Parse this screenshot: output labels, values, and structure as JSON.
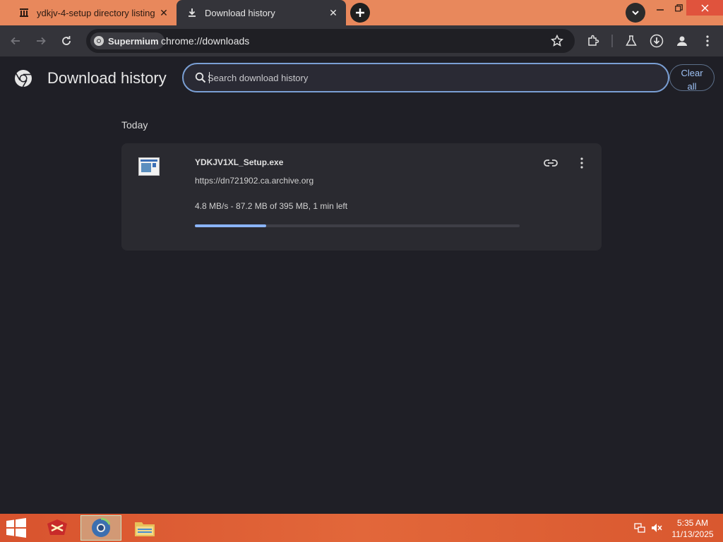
{
  "tabs": [
    {
      "title": "ydkjv-4-setup directory listing",
      "icon": "archive-icon",
      "active": false
    },
    {
      "title": "Download history",
      "icon": "download-icon",
      "active": true
    }
  ],
  "toolbar": {
    "chip_label": "Supermium",
    "url": "chrome://downloads"
  },
  "page": {
    "title": "Download history",
    "search_placeholder": "Search download history",
    "clear_all_line1": "Clear",
    "clear_all_line2": "all",
    "date_heading": "Today"
  },
  "download": {
    "file_name": "YDKJV1XL_Setup.exe",
    "source": "https://dn721902.ca.archive.org",
    "status": "4.8 MB/s - 87.2 MB of 395 MB, 1 min left",
    "progress_fraction": 0.22
  },
  "taskbar": {
    "time": "5:35 AM",
    "date": "11/13/2025"
  },
  "colors": {
    "tabstrip": "#e8885c",
    "accent": "#8ab4f8",
    "page_bg": "#1f1f26",
    "card_bg": "#2a2a30"
  }
}
